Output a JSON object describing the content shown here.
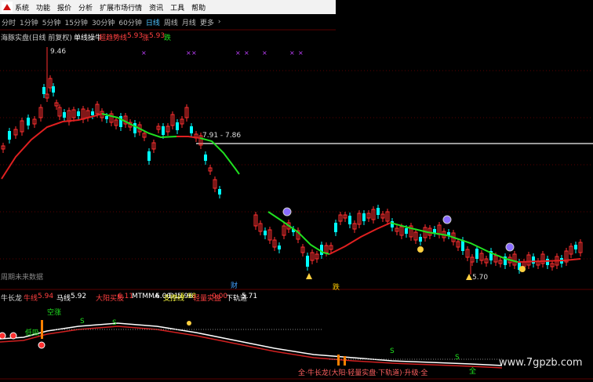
{
  "menu": {
    "items": [
      "系统",
      "功能",
      "报价",
      "分析",
      "扩展市场行情",
      "资讯",
      "工具",
      "帮助"
    ]
  },
  "periods": {
    "items": [
      "分时",
      "1分钟",
      "5分钟",
      "15分钟",
      "30分钟",
      "60分钟",
      "日线",
      "周线",
      "月线",
      "更多"
    ],
    "active": "日线",
    "more_arrow": "›"
  },
  "main_panel": {
    "title": "海豚实盘(日线 前复权)",
    "indicator_name": "单线操牛",
    "label_a": "超趋势线",
    "value_a": "5.93",
    "label_b": "涨",
    "value_b": "5.93",
    "label_c": "跌",
    "high_marker": "9.46",
    "mid_marker": "7.91 - 7.86",
    "low_marker": "5.70",
    "bottom_note": "周期未来数据",
    "tag_a": "跌",
    "tag_b": "财"
  },
  "sub_panel": {
    "name": "牛长龙",
    "items": [
      {
        "label": "牛线",
        "value": "5.94",
        "color": "#ff4040"
      },
      {
        "label": "马线",
        "value": "5.92",
        "color": "#ffffff"
      },
      {
        "label": "大阳买股",
        "value": "6.11",
        "color": "#ff4040"
      },
      {
        "label": "MTMMA",
        "value": "6.00",
        "color": "#ffffff"
      },
      {
        "label": "D1",
        "value": "5.96",
        "color": "#ffffff"
      },
      {
        "label": "支撑线",
        "value": "5.98",
        "color": "#ffff40"
      },
      {
        "label": "轻量实盘",
        "value": "0.00",
        "color": "#ff4040"
      },
      {
        "label": "下轨道",
        "value": "5.71",
        "color": "#ffffff"
      }
    ],
    "marker_up": "空涨",
    "marker_left": "低吸",
    "marker_s": "S",
    "bottom_text": "全·牛长龙(大阳·轻量实盘·下轨道)·升级·全",
    "bottom_tag": "全"
  },
  "watermark": "www.7gpzb.com",
  "colors": {
    "up": "#ff3030",
    "down": "#00ffff",
    "green_line": "#20e020",
    "red_line": "#e02020",
    "grid": "#5a0000"
  }
}
